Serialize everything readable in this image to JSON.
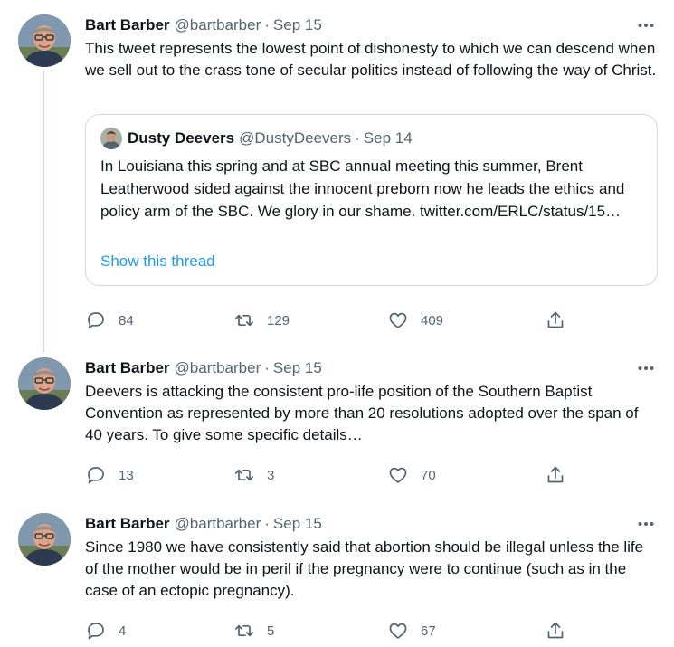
{
  "tweets": [
    {
      "name": "Bart Barber",
      "handle": "@bartbarber",
      "separator": "·",
      "date": "Sep 15",
      "text": "This tweet represents the lowest point of dishonesty to which we can descend when we sell out to the crass tone of secular politics instead of following the way of Christ.",
      "replies": "84",
      "retweets": "129",
      "likes": "409",
      "quote": {
        "name": "Dusty Deevers",
        "handle": "@DustyDeevers",
        "separator": "·",
        "date": "Sep 14",
        "text": "In Louisiana this spring and at SBC annual meeting this summer, Brent Leatherwood sided against the innocent preborn now he leads the ethics and policy arm of the SBC. We glory in our shame. twitter.com/ERLC/status/15…",
        "show_thread": "Show this thread"
      }
    },
    {
      "name": "Bart Barber",
      "handle": "@bartbarber",
      "separator": "·",
      "date": "Sep 15",
      "text": "Deevers is attacking the consistent pro-life position of the Southern Baptist Convention as represented by more than 20 resolutions adopted over the span of 40 years. To give some specific details…",
      "replies": "13",
      "retweets": "3",
      "likes": "70"
    },
    {
      "name": "Bart Barber",
      "handle": "@bartbarber",
      "separator": "·",
      "date": "Sep 15",
      "text": "Since 1980 we have consistently said that abortion should be illegal unless the life of the mother would be in peril if the pregnancy were to continue (such as in the case of an ectopic pregnancy).",
      "replies": "4",
      "retweets": "5",
      "likes": "67"
    }
  ],
  "icons": {
    "more": "more-horizontal-icon",
    "reply": "reply-icon",
    "retweet": "retweet-icon",
    "like": "heart-icon",
    "share": "share-icon"
  },
  "colors": {
    "text": "#0f1419",
    "secondary": "#536471",
    "link": "#1d9bf0",
    "border": "#cfd9de"
  }
}
